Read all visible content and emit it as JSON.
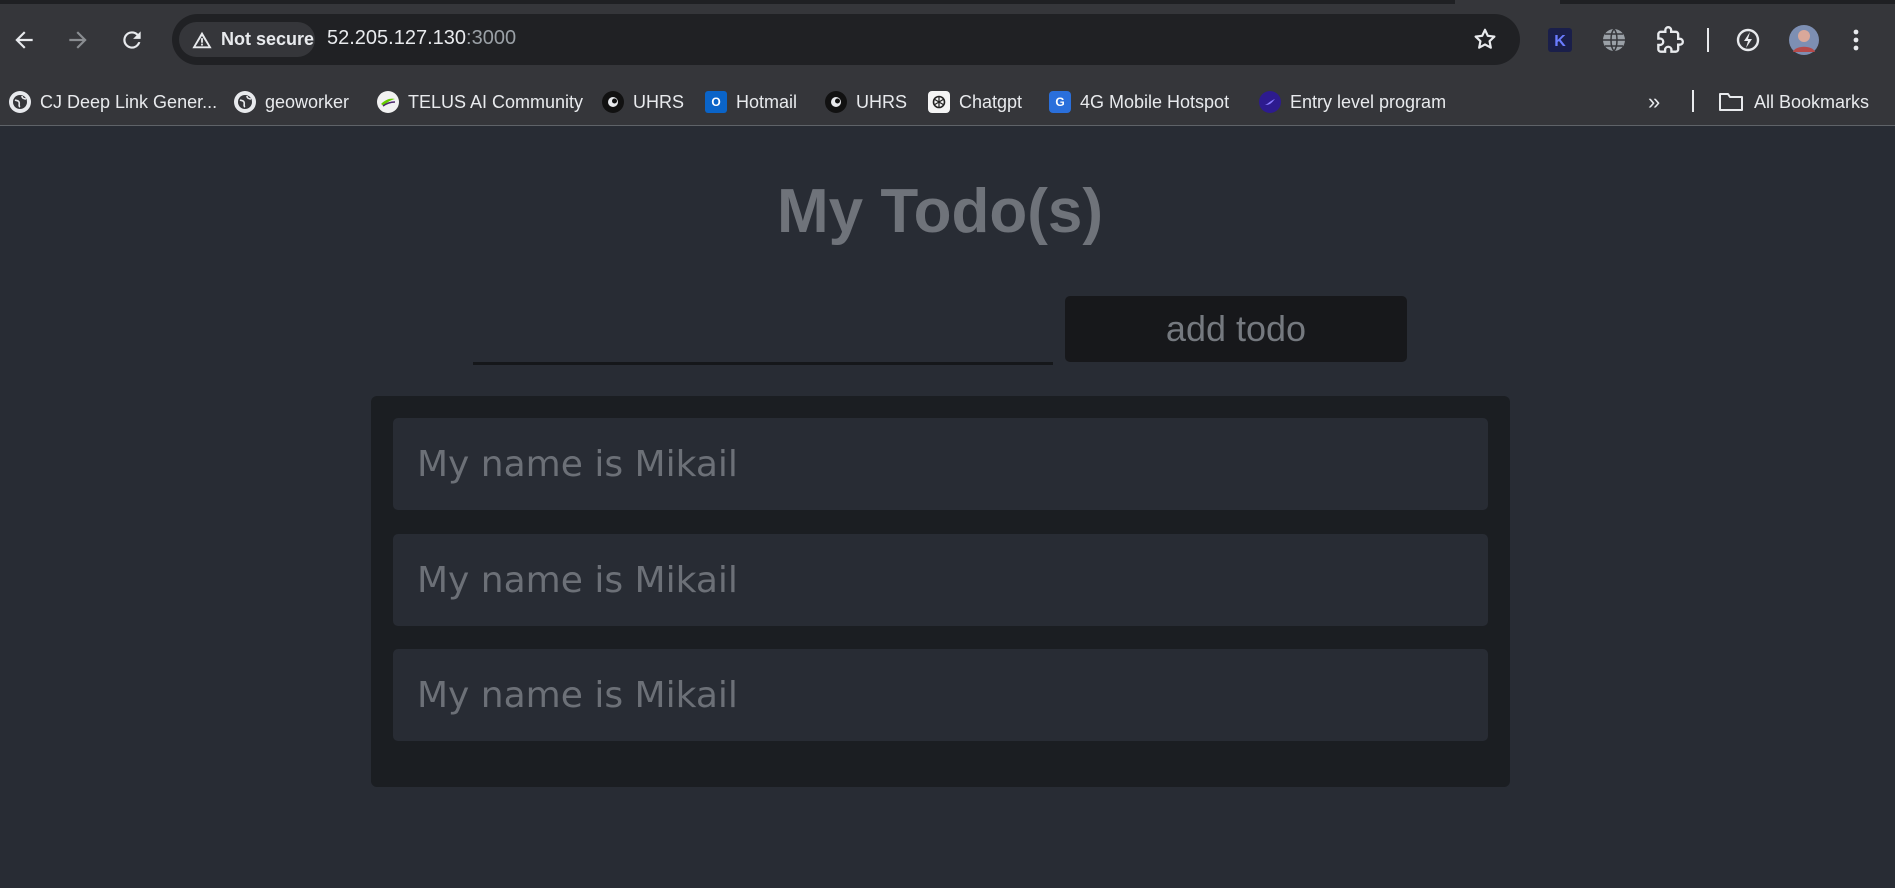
{
  "browser": {
    "security_label": "Not secure",
    "url_host": "52.205.127.130",
    "url_port": ":3000",
    "bookmarks": [
      {
        "label": "CJ Deep Link Gener...",
        "icon": "globe-icon"
      },
      {
        "label": "geoworker",
        "icon": "globe-icon"
      },
      {
        "label": "TELUS AI Community",
        "icon": "telus-icon"
      },
      {
        "label": "UHRS",
        "icon": "uhrs-icon"
      },
      {
        "label": "Hotmail",
        "icon": "outlook-icon"
      },
      {
        "label": "UHRS",
        "icon": "uhrs-icon"
      },
      {
        "label": "Chatgpt",
        "icon": "chatgpt-icon"
      },
      {
        "label": "4G Mobile Hotspot",
        "icon": "hotspot-icon"
      },
      {
        "label": "Entry level program",
        "icon": "program-icon"
      }
    ],
    "all_bookmarks_label": "All Bookmarks"
  },
  "app": {
    "title": "My Todo(s)",
    "input_value": "",
    "add_button_label": "add todo",
    "todos": [
      {
        "text": "My name is Mikail"
      },
      {
        "text": "My name is Mikail"
      },
      {
        "text": "My name is Mikail"
      }
    ]
  }
}
